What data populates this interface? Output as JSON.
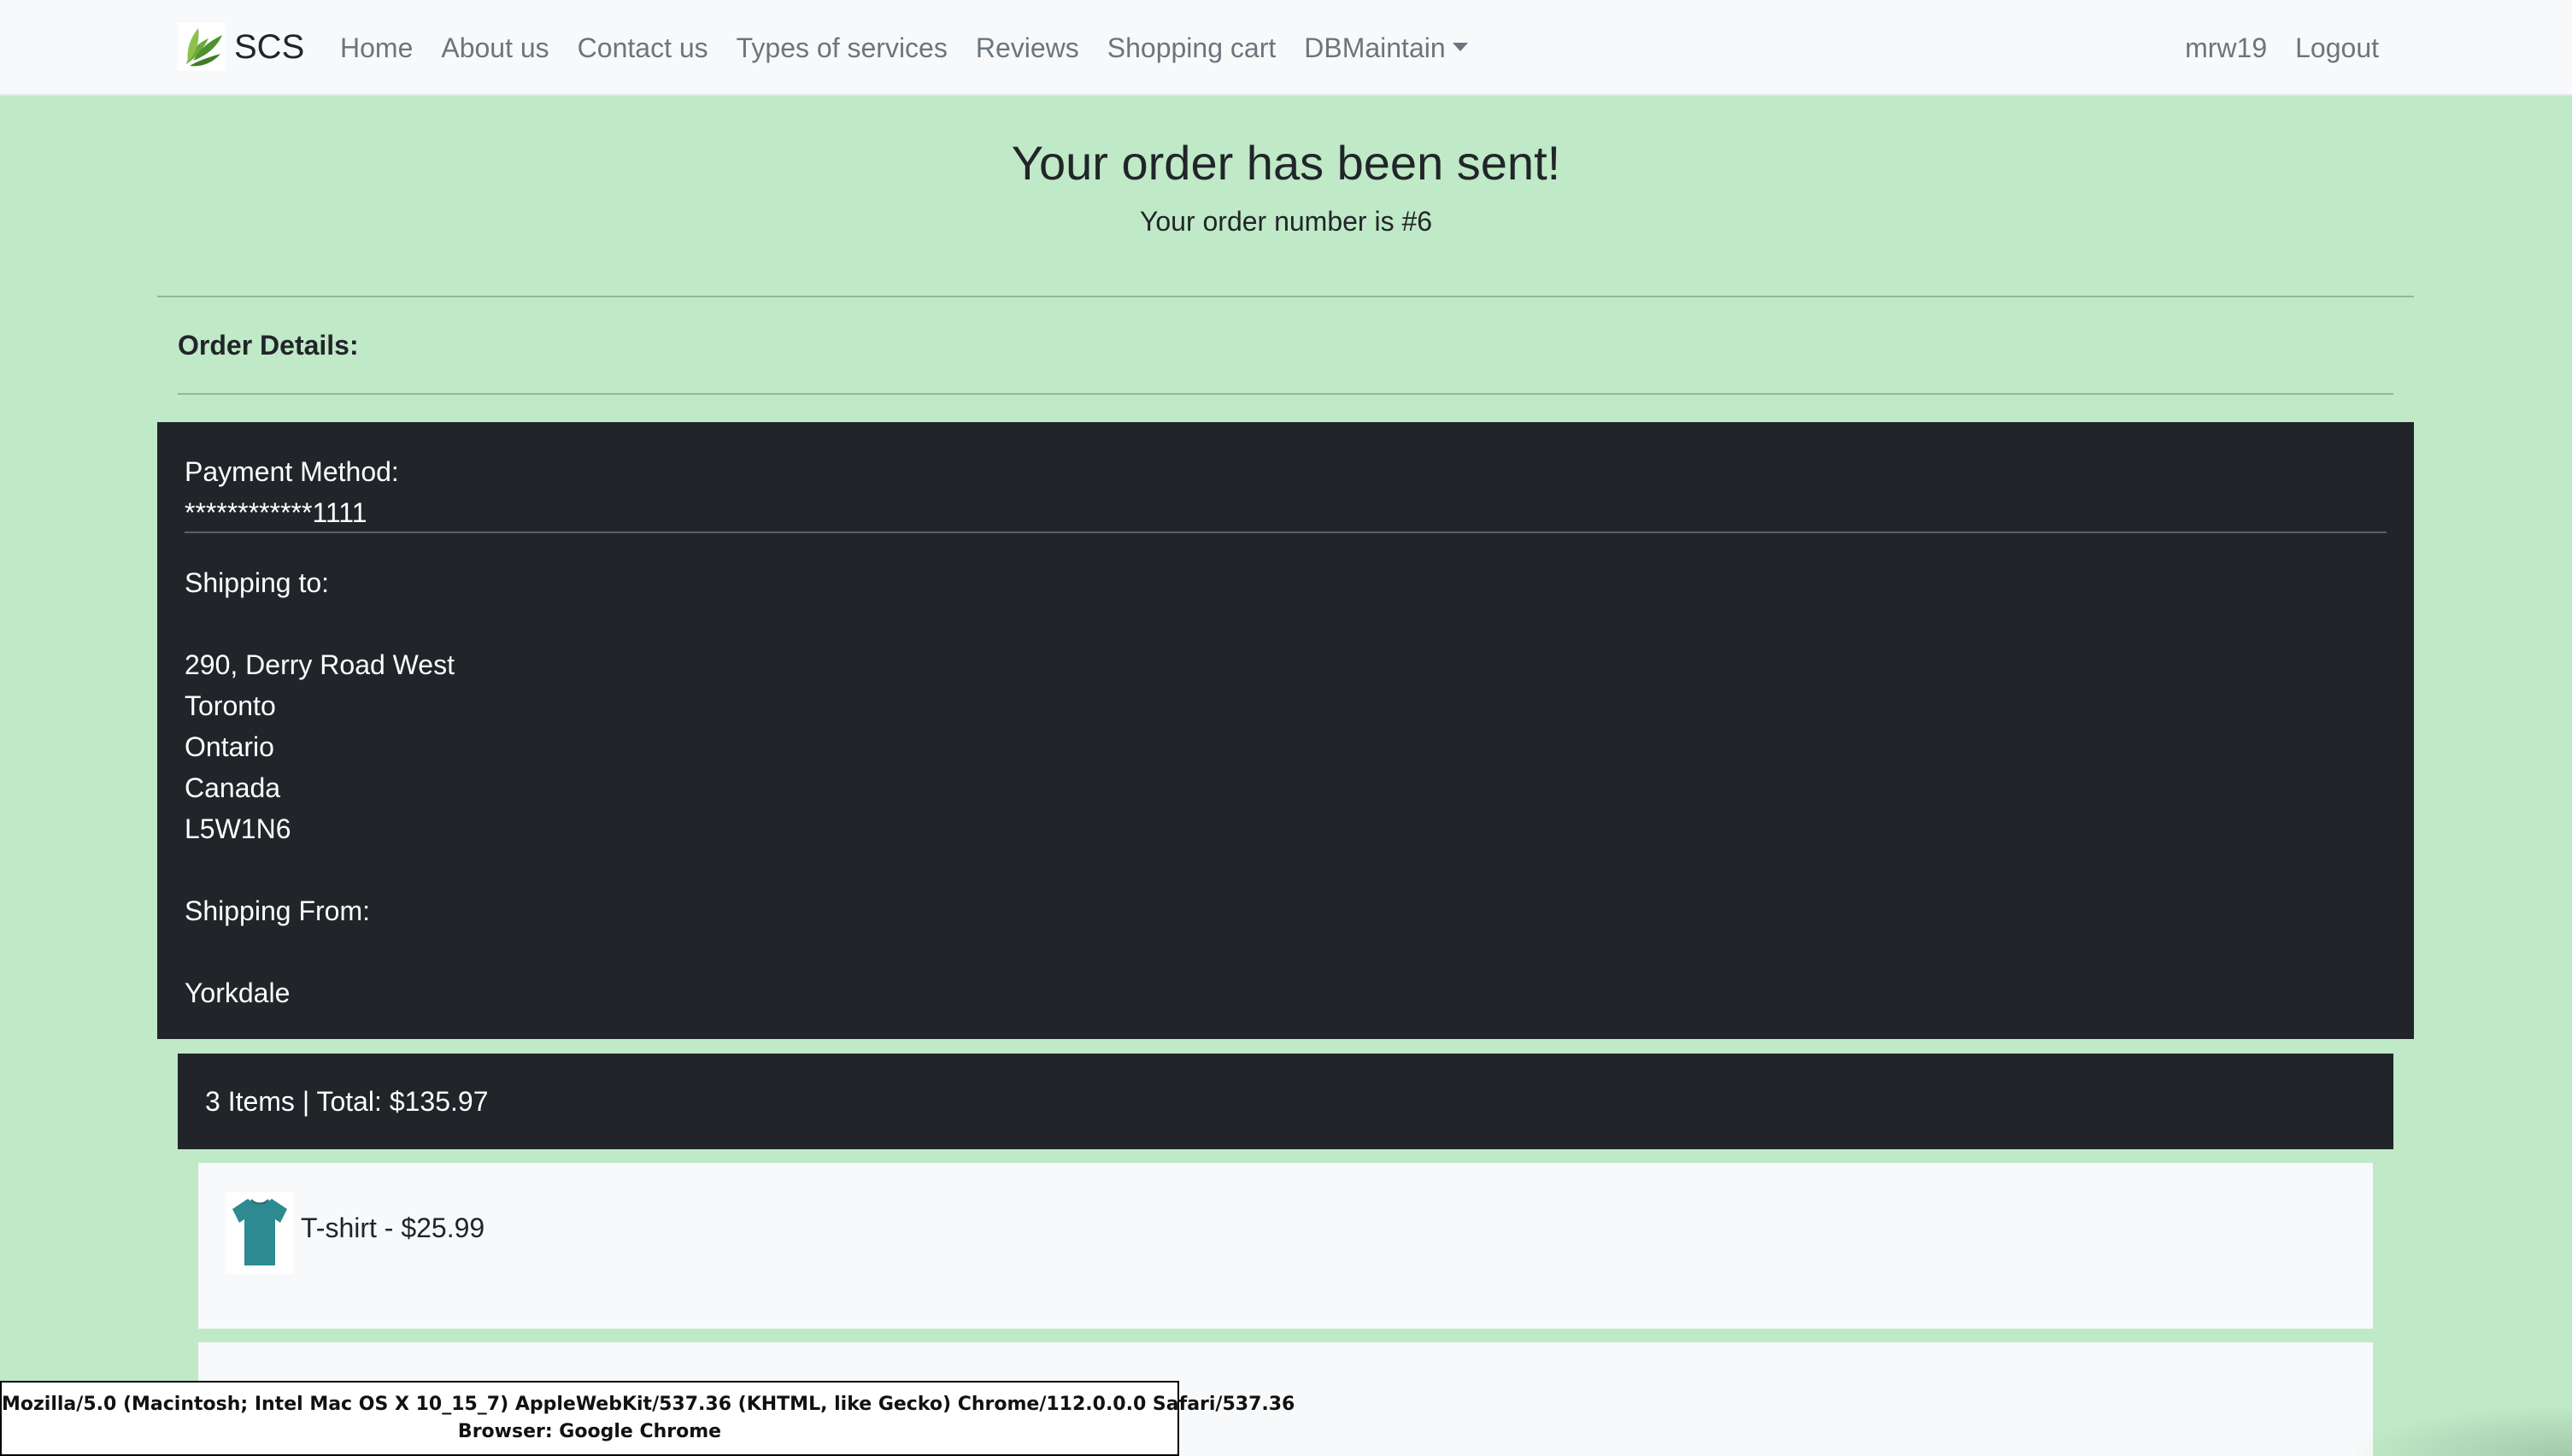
{
  "navbar": {
    "brand": "SCS",
    "links": [
      {
        "label": "Home"
      },
      {
        "label": "About us"
      },
      {
        "label": "Contact us"
      },
      {
        "label": "Types of services"
      },
      {
        "label": "Reviews"
      },
      {
        "label": "Shopping cart"
      },
      {
        "label": "DBMaintain"
      }
    ],
    "user": "mrw19",
    "logout": "Logout"
  },
  "header": {
    "title": "Your order has been sent!",
    "subtitle": "Your order number is #6"
  },
  "details": {
    "heading": "Order Details:",
    "payment_label": "Payment Method:",
    "payment_value": "************1111",
    "shipping_to_label": "Shipping to:",
    "address": {
      "street": "290, Derry Road West",
      "city": "Toronto",
      "province": "Ontario",
      "country": "Canada",
      "postal": "L5W1N6"
    },
    "shipping_from_label": "Shipping From:",
    "shipping_from_value": "Yorkdale"
  },
  "summary": {
    "text": "3 Items | Total: $135.97"
  },
  "items": [
    {
      "text": "T-shirt - $25.99"
    }
  ],
  "overlay": {
    "user_agent": "Mozilla/5.0 (Macintosh; Intel Mac OS X 10_15_7) AppleWebKit/537.36 (KHTML, like Gecko) Chrome/112.0.0.0 Safari/537.36",
    "browser": "Browser: Google Chrome"
  },
  "colors": {
    "page_bg": "#bfe9c7",
    "navbar_bg": "#f8f9fa",
    "dark_card": "#212529",
    "item_card": "#f8f9fa",
    "tshirt": "#2e8a91",
    "logo_leaf": "#4a8a2a"
  }
}
